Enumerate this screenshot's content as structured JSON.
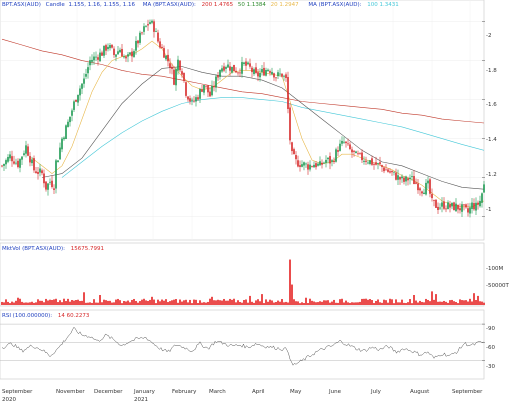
{
  "main_panel": {
    "legend": {
      "symbol": "BPT.ASX(AUD)",
      "candle_label": "Candle",
      "candle_values": "1.155, 1.16, 1.155, 1.16",
      "ma_label_1": "MA (BPT.ASX(AUD):",
      "ma200_value": "200 1.4765",
      "ma50_value": "50 1.1384",
      "ma20_value": "20 1.2947",
      "ma_label_2": "MA (BPT.ASX(AUD):",
      "ma100_value": "100 1.3431"
    },
    "y_ticks": [
      "-2",
      "-1.8",
      "-1.6",
      "-1.4",
      "-1.2",
      "-1"
    ]
  },
  "volume_panel": {
    "legend_label": "MktVol (BPT.ASX(AUD):",
    "legend_value": "15675.7991",
    "y_ticks": [
      "-100M",
      "-50000T"
    ]
  },
  "rsi_panel": {
    "legend_label": "RSI (100.000000):",
    "legend_value": "14 60.2273",
    "y_ticks": [
      "-90",
      "-60",
      "-30"
    ]
  },
  "x_axis": {
    "month_labels": [
      "September",
      "November",
      "December",
      "January",
      "February",
      "March",
      "April",
      "May",
      "June",
      "July",
      "August",
      "September"
    ],
    "year_labels": [
      "2020",
      "2021"
    ]
  },
  "colors": {
    "up": "#1a9850",
    "down": "#d62728",
    "ma200": "#c0392b",
    "ma50": "#555555",
    "ma20": "#e8b84a",
    "ma100": "#45c8d8",
    "volume": "#e00000",
    "rsi": "#555555",
    "legend_blue": "#1f3fbf",
    "legend_red": "#d62728",
    "legend_green": "#2e8b2e"
  },
  "chart_data": {
    "type": "candlestick",
    "ylim": [
      0.9,
      2.07
    ],
    "price_path": [
      [
        0,
        1.26
      ],
      [
        8,
        1.31
      ],
      [
        16,
        1.27
      ],
      [
        24,
        1.36
      ],
      [
        32,
        1.24
      ],
      [
        40,
        1.22
      ],
      [
        44,
        1.15
      ],
      [
        48,
        1.18
      ],
      [
        52,
        1.16
      ],
      [
        55,
        1.28
      ],
      [
        60,
        1.4
      ],
      [
        66,
        1.48
      ],
      [
        72,
        1.58
      ],
      [
        76,
        1.64
      ],
      [
        82,
        1.7
      ],
      [
        88,
        1.8
      ],
      [
        94,
        1.82
      ],
      [
        100,
        1.84
      ],
      [
        106,
        1.88
      ],
      [
        112,
        1.83
      ],
      [
        118,
        1.86
      ],
      [
        124,
        1.8
      ],
      [
        130,
        1.84
      ],
      [
        136,
        1.9
      ],
      [
        142,
        1.96
      ],
      [
        148,
        2.0
      ],
      [
        152,
        1.97
      ],
      [
        156,
        1.9
      ],
      [
        162,
        1.84
      ],
      [
        168,
        1.78
      ],
      [
        172,
        1.7
      ],
      [
        176,
        1.8
      ],
      [
        180,
        1.75
      ],
      [
        184,
        1.64
      ],
      [
        190,
        1.58
      ],
      [
        196,
        1.62
      ],
      [
        202,
        1.68
      ],
      [
        208,
        1.62
      ],
      [
        214,
        1.7
      ],
      [
        218,
        1.76
      ],
      [
        224,
        1.78
      ],
      [
        230,
        1.76
      ],
      [
        236,
        1.75
      ],
      [
        242,
        1.78
      ],
      [
        248,
        1.76
      ],
      [
        254,
        1.72
      ],
      [
        260,
        1.74
      ],
      [
        266,
        1.76
      ],
      [
        270,
        1.75
      ],
      [
        274,
        1.72
      ],
      [
        280,
        1.73
      ],
      [
        284,
        1.7
      ],
      [
        289,
        1.32
      ],
      [
        294,
        1.28
      ],
      [
        300,
        1.27
      ],
      [
        306,
        1.26
      ],
      [
        312,
        1.27
      ],
      [
        318,
        1.26
      ],
      [
        324,
        1.29
      ],
      [
        330,
        1.28
      ],
      [
        336,
        1.35
      ],
      [
        342,
        1.38
      ],
      [
        348,
        1.34
      ],
      [
        354,
        1.31
      ],
      [
        360,
        1.3
      ],
      [
        366,
        1.29
      ],
      [
        372,
        1.27
      ],
      [
        378,
        1.26
      ],
      [
        384,
        1.24
      ],
      [
        390,
        1.22
      ],
      [
        396,
        1.2
      ],
      [
        402,
        1.18
      ],
      [
        408,
        1.2
      ],
      [
        414,
        1.17
      ],
      [
        420,
        1.14
      ],
      [
        426,
        1.16
      ],
      [
        430,
        1.07
      ],
      [
        436,
        1.05
      ],
      [
        442,
        1.06
      ],
      [
        448,
        1.05
      ],
      [
        454,
        1.05
      ],
      [
        460,
        1.04
      ],
      [
        466,
        1.02
      ],
      [
        470,
        1.06
      ],
      [
        474,
        1.05
      ],
      [
        478,
        1.08
      ],
      [
        482,
        1.16
      ]
    ],
    "ma20_path": [
      [
        30,
        1.3
      ],
      [
        40,
        1.26
      ],
      [
        50,
        1.22
      ],
      [
        60,
        1.26
      ],
      [
        70,
        1.36
      ],
      [
        80,
        1.5
      ],
      [
        90,
        1.64
      ],
      [
        100,
        1.74
      ],
      [
        110,
        1.8
      ],
      [
        120,
        1.82
      ],
      [
        130,
        1.83
      ],
      [
        140,
        1.86
      ],
      [
        150,
        1.9
      ],
      [
        160,
        1.86
      ],
      [
        170,
        1.78
      ],
      [
        180,
        1.72
      ],
      [
        190,
        1.67
      ],
      [
        200,
        1.65
      ],
      [
        210,
        1.66
      ],
      [
        220,
        1.7
      ],
      [
        230,
        1.74
      ],
      [
        240,
        1.75
      ],
      [
        250,
        1.75
      ],
      [
        260,
        1.74
      ],
      [
        270,
        1.73
      ],
      [
        280,
        1.72
      ],
      [
        290,
        1.56
      ],
      [
        300,
        1.4
      ],
      [
        310,
        1.29
      ],
      [
        320,
        1.27
      ],
      [
        330,
        1.28
      ],
      [
        340,
        1.32
      ],
      [
        350,
        1.32
      ],
      [
        360,
        1.3
      ],
      [
        370,
        1.28
      ],
      [
        380,
        1.26
      ],
      [
        390,
        1.24
      ],
      [
        400,
        1.21
      ],
      [
        410,
        1.19
      ],
      [
        420,
        1.16
      ],
      [
        430,
        1.12
      ],
      [
        440,
        1.08
      ],
      [
        450,
        1.06
      ],
      [
        460,
        1.05
      ],
      [
        470,
        1.05
      ],
      [
        482,
        1.08
      ]
    ],
    "ma50_path": [
      [
        40,
        1.2
      ],
      [
        60,
        1.22
      ],
      [
        80,
        1.3
      ],
      [
        100,
        1.44
      ],
      [
        120,
        1.58
      ],
      [
        140,
        1.68
      ],
      [
        160,
        1.76
      ],
      [
        180,
        1.77
      ],
      [
        200,
        1.74
      ],
      [
        220,
        1.72
      ],
      [
        240,
        1.72
      ],
      [
        260,
        1.7
      ],
      [
        280,
        1.66
      ],
      [
        300,
        1.58
      ],
      [
        320,
        1.5
      ],
      [
        340,
        1.42
      ],
      [
        360,
        1.34
      ],
      [
        380,
        1.28
      ],
      [
        400,
        1.26
      ],
      [
        420,
        1.22
      ],
      [
        440,
        1.18
      ],
      [
        460,
        1.15
      ],
      [
        482,
        1.14
      ]
    ],
    "ma100_path": [
      [
        60,
        1.2
      ],
      [
        80,
        1.28
      ],
      [
        100,
        1.36
      ],
      [
        120,
        1.43
      ],
      [
        140,
        1.49
      ],
      [
        160,
        1.54
      ],
      [
        180,
        1.58
      ],
      [
        200,
        1.6
      ],
      [
        220,
        1.61
      ],
      [
        240,
        1.61
      ],
      [
        260,
        1.6
      ],
      [
        280,
        1.59
      ],
      [
        300,
        1.56
      ],
      [
        320,
        1.54
      ],
      [
        340,
        1.52
      ],
      [
        360,
        1.5
      ],
      [
        380,
        1.48
      ],
      [
        400,
        1.46
      ],
      [
        420,
        1.43
      ],
      [
        440,
        1.4
      ],
      [
        460,
        1.37
      ],
      [
        482,
        1.34
      ]
    ],
    "ma200_path": [
      [
        0,
        1.91
      ],
      [
        20,
        1.88
      ],
      [
        40,
        1.85
      ],
      [
        60,
        1.83
      ],
      [
        80,
        1.8
      ],
      [
        100,
        1.78
      ],
      [
        120,
        1.75
      ],
      [
        140,
        1.73
      ],
      [
        160,
        1.72
      ],
      [
        180,
        1.7
      ],
      [
        200,
        1.68
      ],
      [
        220,
        1.66
      ],
      [
        240,
        1.64
      ],
      [
        260,
        1.63
      ],
      [
        280,
        1.61
      ],
      [
        300,
        1.59
      ],
      [
        320,
        1.58
      ],
      [
        340,
        1.57
      ],
      [
        360,
        1.56
      ],
      [
        380,
        1.55
      ],
      [
        400,
        1.53
      ],
      [
        420,
        1.52
      ],
      [
        440,
        1.5
      ],
      [
        460,
        1.49
      ],
      [
        482,
        1.48
      ]
    ],
    "volume_scale_max": 110,
    "volume_spikes": [
      [
        288,
        100
      ],
      [
        290,
        45
      ],
      [
        133,
        34
      ],
      [
        82,
        28
      ],
      [
        98,
        22
      ],
      [
        260,
        24
      ],
      [
        412,
        22
      ],
      [
        430,
        30
      ],
      [
        434,
        24
      ],
      [
        472,
        26
      ],
      [
        476,
        20
      ],
      [
        210,
        18
      ],
      [
        16,
        16
      ],
      [
        150,
        18
      ],
      [
        304,
        16
      ],
      [
        248,
        20
      ]
    ],
    "rsi_ylim": [
      0,
      100
    ],
    "rsi_reference_lines": [
      30,
      60,
      90
    ],
    "rsi_path": [
      [
        0,
        52
      ],
      [
        10,
        58
      ],
      [
        20,
        46
      ],
      [
        30,
        55
      ],
      [
        40,
        48
      ],
      [
        48,
        38
      ],
      [
        56,
        50
      ],
      [
        64,
        66
      ],
      [
        72,
        82
      ],
      [
        80,
        72
      ],
      [
        88,
        70
      ],
      [
        96,
        62
      ],
      [
        104,
        72
      ],
      [
        112,
        64
      ],
      [
        120,
        55
      ],
      [
        128,
        62
      ],
      [
        136,
        66
      ],
      [
        144,
        68
      ],
      [
        150,
        60
      ],
      [
        158,
        50
      ],
      [
        166,
        44
      ],
      [
        174,
        56
      ],
      [
        182,
        52
      ],
      [
        190,
        46
      ],
      [
        198,
        58
      ],
      [
        206,
        50
      ],
      [
        214,
        62
      ],
      [
        222,
        58
      ],
      [
        230,
        54
      ],
      [
        238,
        56
      ],
      [
        246,
        52
      ],
      [
        254,
        58
      ],
      [
        262,
        54
      ],
      [
        270,
        52
      ],
      [
        278,
        50
      ],
      [
        286,
        48
      ],
      [
        290,
        22
      ],
      [
        298,
        28
      ],
      [
        306,
        36
      ],
      [
        314,
        44
      ],
      [
        322,
        50
      ],
      [
        330,
        54
      ],
      [
        338,
        62
      ],
      [
        346,
        56
      ],
      [
        354,
        50
      ],
      [
        362,
        46
      ],
      [
        370,
        52
      ],
      [
        378,
        48
      ],
      [
        386,
        54
      ],
      [
        394,
        44
      ],
      [
        402,
        50
      ],
      [
        410,
        46
      ],
      [
        418,
        40
      ],
      [
        426,
        44
      ],
      [
        432,
        34
      ],
      [
        440,
        42
      ],
      [
        448,
        38
      ],
      [
        456,
        46
      ],
      [
        462,
        58
      ],
      [
        470,
        55
      ],
      [
        478,
        60
      ],
      [
        482,
        60
      ]
    ]
  }
}
